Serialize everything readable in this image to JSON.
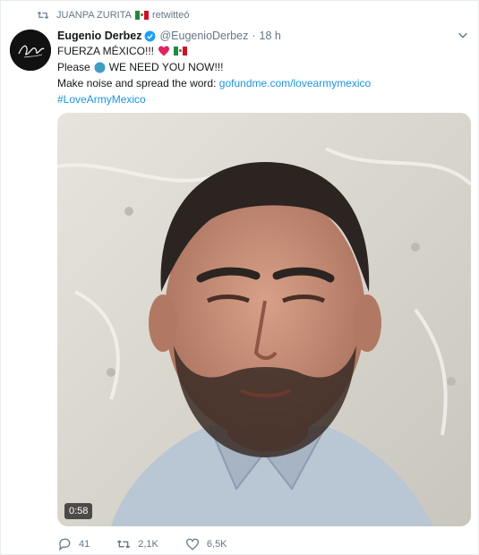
{
  "retweet": {
    "user": "JUANPA ZURITA",
    "label": "retwitteó",
    "icon": "retweet-icon"
  },
  "tweet": {
    "name": "Eugenio Derbez",
    "handle": "@EugenioDerbez",
    "separator": "·",
    "time": "18 h",
    "line1": "FUERZA MÉXICO!!!",
    "line2_before": "Please",
    "line2_after": "WE NEED YOU NOW!!!",
    "line3_before": "Make noise and spread the word:",
    "link": "gofundme.com/lovearmymexico",
    "hashtag": "#LoveArmyMexico"
  },
  "media": {
    "duration": "0:58",
    "type": "video"
  },
  "actions": {
    "replies": "41",
    "retweets": "2,1K",
    "likes": "6,5K"
  },
  "colors": {
    "link": "#1b95e0",
    "muted": "#657786",
    "heart": "#e0245e",
    "verified": "#1da1f2"
  }
}
